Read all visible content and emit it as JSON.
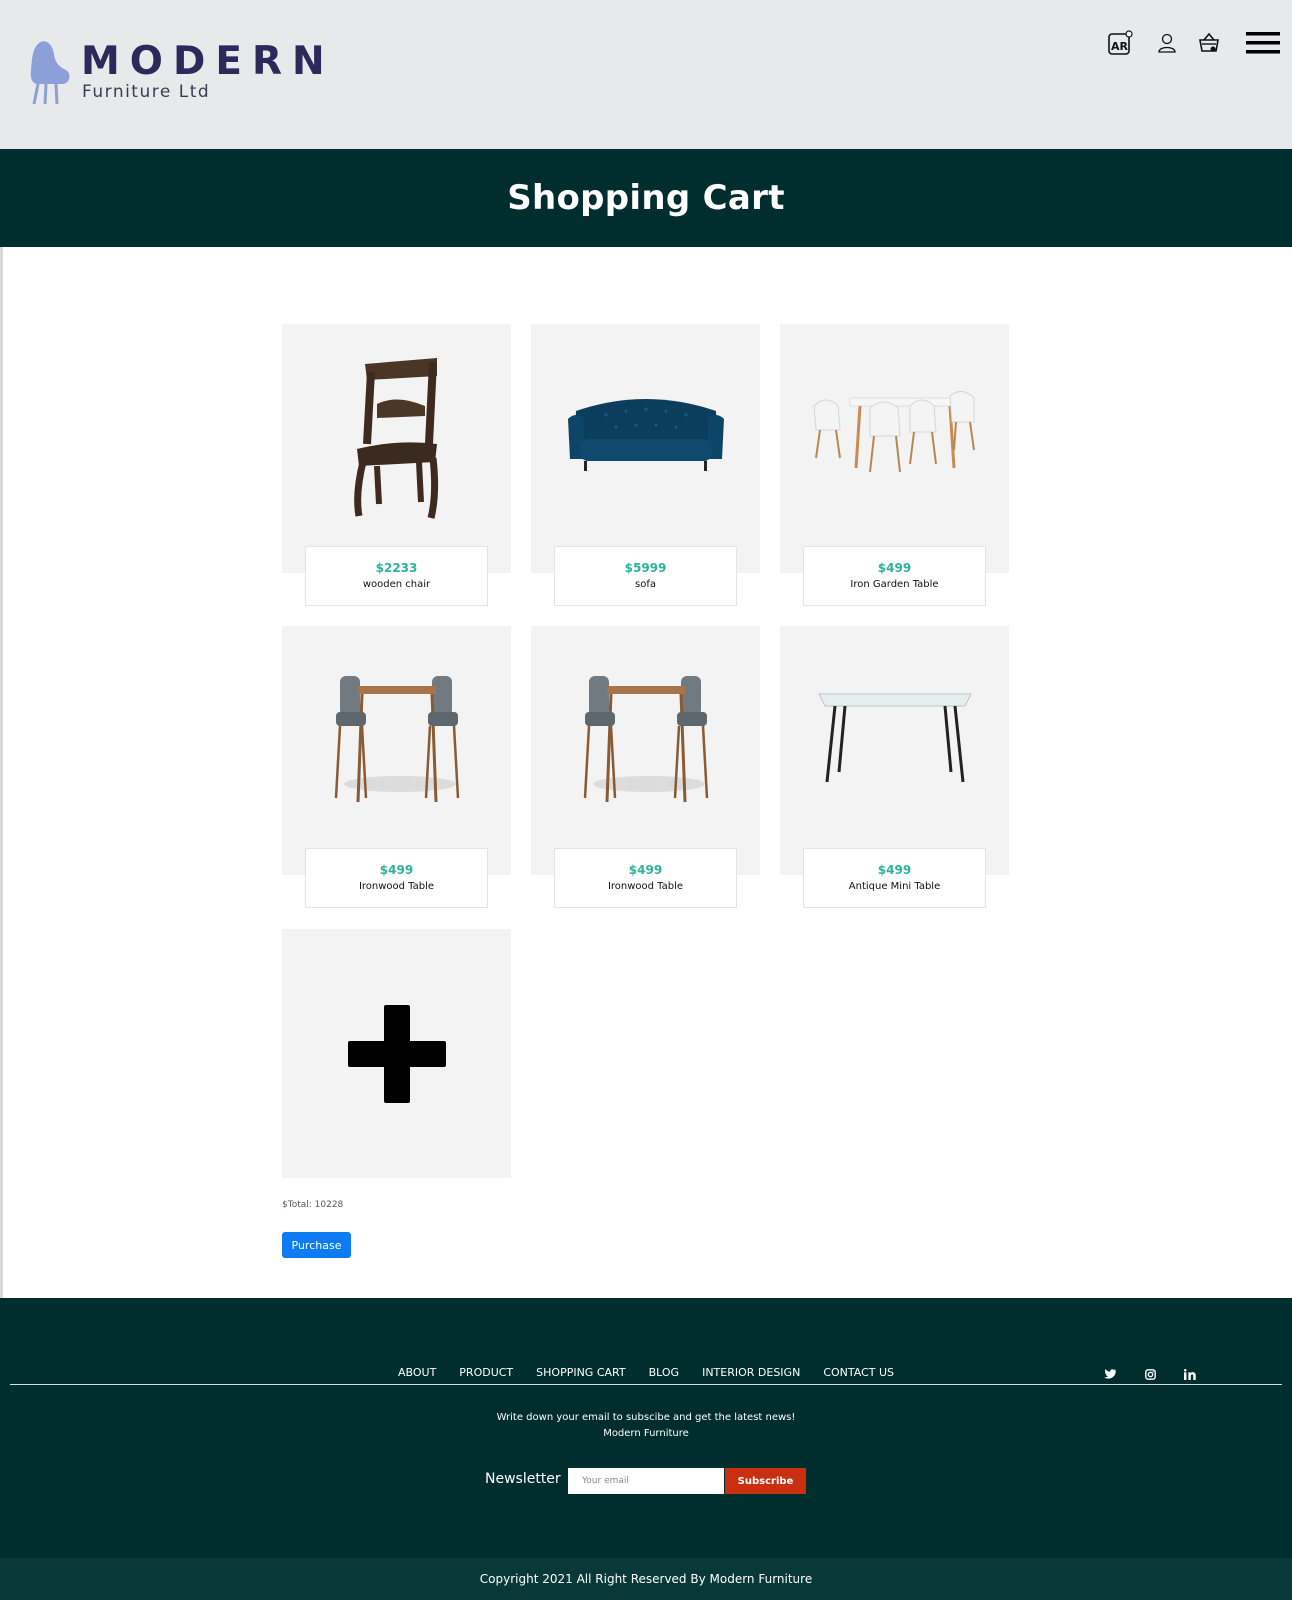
{
  "brand": {
    "name": "MODERN",
    "subtitle": "Furniture Ltd",
    "logo_color": "#8c9fd8",
    "text_color": "#2c2a5a"
  },
  "header": {
    "icons": [
      "ar-icon",
      "user-icon",
      "basket-icon",
      "hamburger-menu-icon"
    ]
  },
  "page": {
    "title": "Shopping Cart"
  },
  "cart": {
    "items": [
      {
        "price": "$2233",
        "name": "wooden chair"
      },
      {
        "price": "$5999",
        "name": "sofa"
      },
      {
        "price": "$499",
        "name": "Iron Garden Table"
      },
      {
        "price": "$499",
        "name": "Ironwood Table"
      },
      {
        "price": "$499",
        "name": "Ironwood Table"
      },
      {
        "price": "$499",
        "name": "Antique Mini Table"
      }
    ],
    "total_label": "$Total: 10228",
    "purchase_label": "Purchase"
  },
  "footer": {
    "nav": [
      "ABOUT",
      "PRODUCT",
      "SHOPPING CART",
      "BLOG",
      "INTERIOR DESIGN",
      "CONTACT US"
    ],
    "social": [
      "twitter-icon",
      "instagram-icon",
      "linkedin-icon"
    ],
    "subscribe_text_1": "Write down your email to subscibe and get the latest news!",
    "subscribe_text_2": "Modern Furniture",
    "newsletter_label": "Newsletter",
    "email_placeholder": "Your email",
    "subscribe_label": "Subscribe",
    "copyright": "Copyright 2021 All Right Reserved By Modern Furniture"
  },
  "colors": {
    "banner": "#002e2e",
    "price": "#2bb39b",
    "purchase": "#0d7cf2",
    "subscribe": "#c9300f"
  }
}
